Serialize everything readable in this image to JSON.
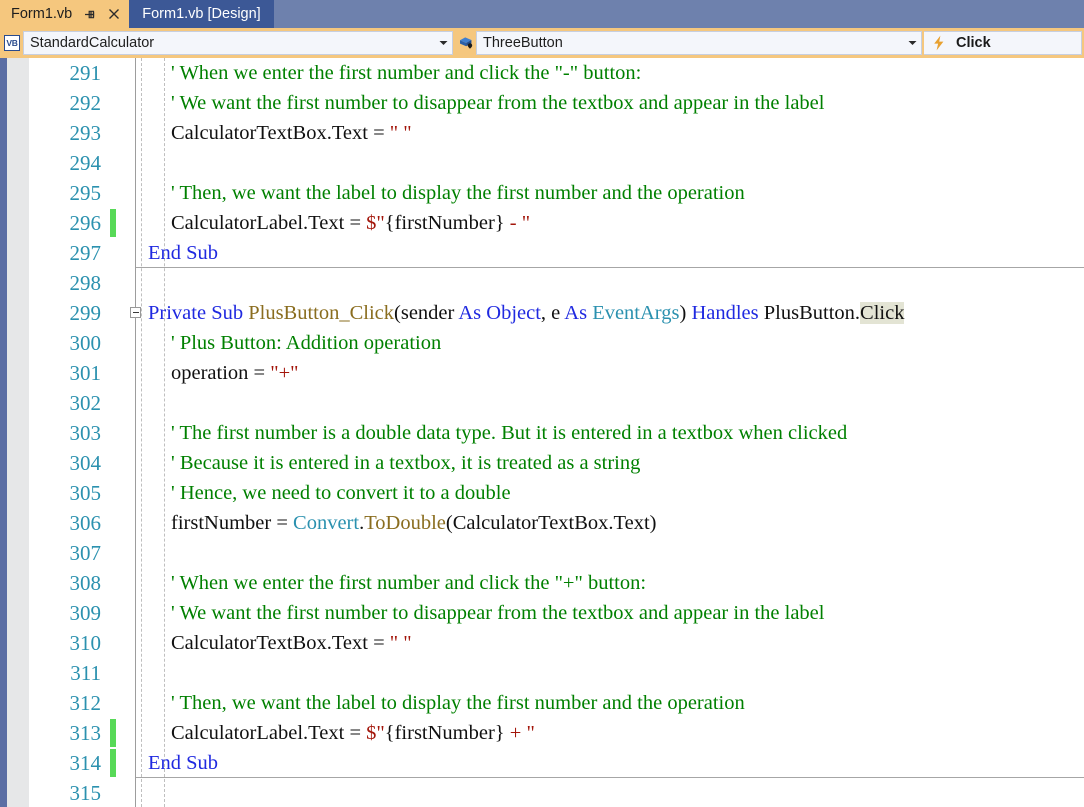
{
  "window": {
    "tabs": [
      {
        "label": "Form1.vb",
        "active": true,
        "pin_icon": "pin-icon",
        "close_icon": "close-icon"
      },
      {
        "label": "Form1.vb [Design]",
        "active": false
      }
    ]
  },
  "navbar": {
    "project_icon": "vb-file-icon",
    "project_icon_label": "VB",
    "type_combo": {
      "value": "StandardCalculator",
      "arrow_icon": "chevron-down-icon"
    },
    "member_combo": {
      "icon": "method-cube-icon",
      "value": "ThreeButton",
      "arrow_icon": "chevron-down-icon"
    },
    "event_pane": {
      "icon": "lightning-bolt-icon",
      "value": "Click"
    }
  },
  "editor": {
    "colors": {
      "comment": "#008000",
      "keyword": "#1f29e0",
      "string": "#a3160b",
      "type": "#2b91af",
      "method": "#8a6d1f",
      "plain": "#111111",
      "linenumber": "#2b91af",
      "changebar": "#57d957",
      "highlight": "#e3e4d4"
    },
    "lines": [
      {
        "number": "291",
        "changed": false,
        "fold": false,
        "separator": false,
        "indent": 1,
        "tokens": [
          {
            "t": "' When we enter the first number and click the \"-\" button:",
            "c": "cmt"
          }
        ]
      },
      {
        "number": "292",
        "changed": false,
        "fold": false,
        "separator": false,
        "indent": 1,
        "tokens": [
          {
            "t": "' We want the first number to disappear from the textbox and appear in the label",
            "c": "cmt"
          }
        ]
      },
      {
        "number": "293",
        "changed": false,
        "fold": false,
        "separator": false,
        "indent": 1,
        "tokens": [
          {
            "t": "CalculatorTextBox.Text ",
            "c": "plain"
          },
          {
            "t": "= ",
            "c": "plain"
          },
          {
            "t": "\" \"",
            "c": "str"
          }
        ]
      },
      {
        "number": "294",
        "changed": false,
        "fold": false,
        "separator": false,
        "indent": 1,
        "tokens": []
      },
      {
        "number": "295",
        "changed": false,
        "fold": false,
        "separator": false,
        "indent": 1,
        "tokens": [
          {
            "t": "' Then, we want the label to display the first number and the operation",
            "c": "cmt"
          }
        ]
      },
      {
        "number": "296",
        "changed": true,
        "fold": false,
        "separator": false,
        "indent": 1,
        "tokens": [
          {
            "t": "CalculatorLabel.Text ",
            "c": "plain"
          },
          {
            "t": "= ",
            "c": "plain"
          },
          {
            "t": "$\"",
            "c": "str"
          },
          {
            "t": "{firstNumber}",
            "c": "plain"
          },
          {
            "t": " - \"",
            "c": "str"
          }
        ]
      },
      {
        "number": "297",
        "changed": false,
        "fold": false,
        "separator": true,
        "indent": 0,
        "tokens": [
          {
            "t": "End Sub",
            "c": "kw"
          }
        ]
      },
      {
        "number": "298",
        "changed": false,
        "fold": false,
        "separator": false,
        "indent": 0,
        "tokens": []
      },
      {
        "number": "299",
        "changed": false,
        "fold": true,
        "separator": false,
        "indent": 0,
        "tokens": [
          {
            "t": "Private Sub ",
            "c": "kw"
          },
          {
            "t": "PlusButton_Click",
            "c": "meth"
          },
          {
            "t": "(sender ",
            "c": "plain"
          },
          {
            "t": "As Object",
            "c": "kw"
          },
          {
            "t": ", e ",
            "c": "plain"
          },
          {
            "t": "As ",
            "c": "kw"
          },
          {
            "t": "EventArgs",
            "c": "type"
          },
          {
            "t": ") ",
            "c": "plain"
          },
          {
            "t": "Handles ",
            "c": "kw"
          },
          {
            "t": "PlusButton.",
            "c": "plain"
          },
          {
            "t": "Click",
            "c": "plain hl"
          }
        ]
      },
      {
        "number": "300",
        "changed": false,
        "fold": false,
        "separator": false,
        "indent": 1,
        "tokens": [
          {
            "t": "' Plus Button: Addition operation",
            "c": "cmt"
          }
        ]
      },
      {
        "number": "301",
        "changed": false,
        "fold": false,
        "separator": false,
        "indent": 1,
        "tokens": [
          {
            "t": "operation ",
            "c": "plain"
          },
          {
            "t": "= ",
            "c": "plain"
          },
          {
            "t": "\"+\"",
            "c": "str"
          }
        ]
      },
      {
        "number": "302",
        "changed": false,
        "fold": false,
        "separator": false,
        "indent": 1,
        "tokens": []
      },
      {
        "number": "303",
        "changed": false,
        "fold": false,
        "separator": false,
        "indent": 1,
        "tokens": [
          {
            "t": "' The first number is a double data type. But it is entered in a textbox when clicked",
            "c": "cmt"
          }
        ]
      },
      {
        "number": "304",
        "changed": false,
        "fold": false,
        "separator": false,
        "indent": 1,
        "tokens": [
          {
            "t": "' Because it is entered in a textbox, it is treated as a string",
            "c": "cmt"
          }
        ]
      },
      {
        "number": "305",
        "changed": false,
        "fold": false,
        "separator": false,
        "indent": 1,
        "tokens": [
          {
            "t": "' Hence, we need to convert it to a double",
            "c": "cmt"
          }
        ]
      },
      {
        "number": "306",
        "changed": false,
        "fold": false,
        "separator": false,
        "indent": 1,
        "tokens": [
          {
            "t": "firstNumber ",
            "c": "plain"
          },
          {
            "t": "= ",
            "c": "plain"
          },
          {
            "t": "Convert",
            "c": "type"
          },
          {
            "t": ".",
            "c": "plain"
          },
          {
            "t": "ToDouble",
            "c": "meth"
          },
          {
            "t": "(CalculatorTextBox.Text)",
            "c": "plain"
          }
        ]
      },
      {
        "number": "307",
        "changed": false,
        "fold": false,
        "separator": false,
        "indent": 1,
        "tokens": []
      },
      {
        "number": "308",
        "changed": false,
        "fold": false,
        "separator": false,
        "indent": 1,
        "tokens": [
          {
            "t": "' When we enter the first number and click the \"+\" button:",
            "c": "cmt"
          }
        ]
      },
      {
        "number": "309",
        "changed": false,
        "fold": false,
        "separator": false,
        "indent": 1,
        "tokens": [
          {
            "t": "' We want the first number to disappear from the textbox and appear in the label",
            "c": "cmt"
          }
        ]
      },
      {
        "number": "310",
        "changed": false,
        "fold": false,
        "separator": false,
        "indent": 1,
        "tokens": [
          {
            "t": "CalculatorTextBox.Text ",
            "c": "plain"
          },
          {
            "t": "= ",
            "c": "plain"
          },
          {
            "t": "\" \"",
            "c": "str"
          }
        ]
      },
      {
        "number": "311",
        "changed": false,
        "fold": false,
        "separator": false,
        "indent": 1,
        "tokens": []
      },
      {
        "number": "312",
        "changed": false,
        "fold": false,
        "separator": false,
        "indent": 1,
        "tokens": [
          {
            "t": "' Then, we want the label to display the first number and the operation",
            "c": "cmt"
          }
        ]
      },
      {
        "number": "313",
        "changed": true,
        "fold": false,
        "separator": false,
        "indent": 1,
        "tokens": [
          {
            "t": "CalculatorLabel.Text ",
            "c": "plain"
          },
          {
            "t": "= ",
            "c": "plain"
          },
          {
            "t": "$\"",
            "c": "str"
          },
          {
            "t": "{firstNumber}",
            "c": "plain"
          },
          {
            "t": " + \"",
            "c": "str"
          }
        ]
      },
      {
        "number": "314",
        "changed": true,
        "fold": false,
        "separator": true,
        "indent": 0,
        "tokens": [
          {
            "t": "End Sub",
            "c": "kw"
          }
        ]
      },
      {
        "number": "315",
        "changed": false,
        "fold": false,
        "separator": false,
        "indent": 0,
        "tokens": []
      }
    ]
  }
}
